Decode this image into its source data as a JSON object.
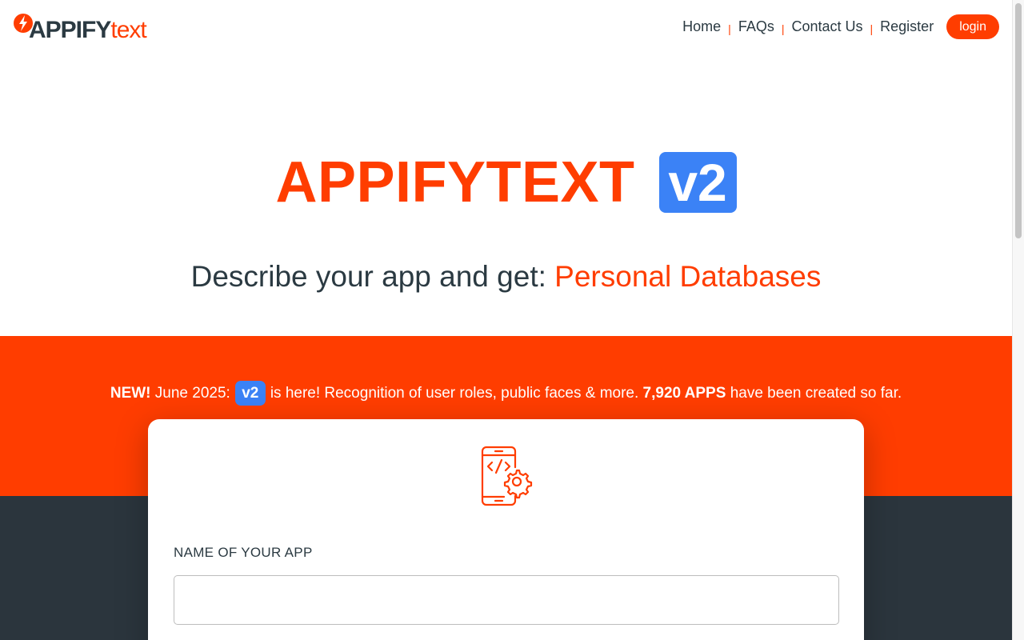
{
  "colors": {
    "accent": "#ff3d00",
    "badge": "#3b82f6",
    "dark": "#2b353d",
    "text": "#2b3a42"
  },
  "logo": {
    "part1": "APPIFY",
    "part2": "text",
    "icon": "lightning-bolt-icon"
  },
  "nav": {
    "items": [
      "Home",
      "FAQs",
      "Contact Us",
      "Register"
    ],
    "separator": "|",
    "login": "login"
  },
  "hero": {
    "title": "APPIFYTEXT",
    "badge": "v2",
    "subtitle_prefix": "Describe your app and get:",
    "subtitle_accent": "Personal Databases"
  },
  "announcement": {
    "new": "NEW!",
    "date": "June 2025:",
    "badge": "v2",
    "text": "is here! Recognition of user roles, public faces & more.",
    "count": "7,920 APPS",
    "suffix": "have been created so far."
  },
  "form": {
    "icon": "mobile-code-gear-icon",
    "name_label": "NAME OF YOUR APP",
    "name_value": "",
    "name_placeholder": ""
  }
}
